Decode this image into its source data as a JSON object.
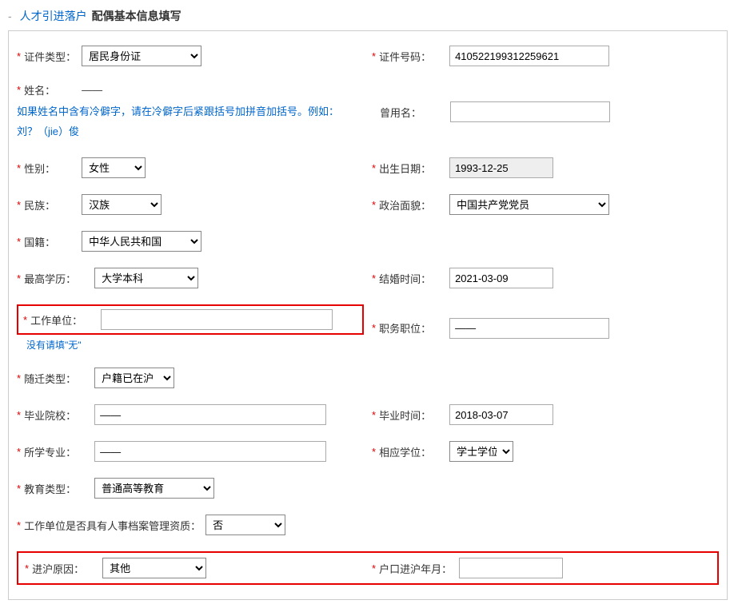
{
  "header": {
    "h1": "人才引进落户",
    "h2": "配偶基本信息填写"
  },
  "labels": {
    "idType": "证件类型：",
    "idNumber": "证件号码：",
    "name": "姓名：",
    "nameHint": "如果姓名中含有冷僻字，请在冷僻字后紧跟括号加拼音加括号。例如：刘？（jie）俊",
    "formerName": "曾用名：",
    "gender": "性别：",
    "birthDate": "出生日期：",
    "ethnicity": "民族：",
    "political": "政治面貌：",
    "nationality": "国籍：",
    "education": "最高学历：",
    "marryTime": "结婚时间：",
    "workUnit": "工作单位：",
    "workUnitHint": "没有请填\"无\"",
    "position": "职务职位：",
    "migrateType": "随迁类型：",
    "gradSchool": "毕业院校：",
    "gradTime": "毕业时间：",
    "major": "所学专业：",
    "degree": "相应学位：",
    "eduType": "教育类型：",
    "archiveQual": "工作单位是否具有人事档案管理资质：",
    "enterReason": "进沪原因：",
    "enterDate": "户口进沪年月："
  },
  "values": {
    "idType": "居民身份证",
    "idNumber": "410522199312259621",
    "name": "——",
    "formerName": "",
    "gender": "女性",
    "birthDate": "1993-12-25",
    "ethnicity": "汉族",
    "political": "中国共产党党员",
    "nationality": "中华人民共和国",
    "education": "大学本科",
    "marryTime": "2021-03-09",
    "workUnit": "",
    "position": "——",
    "migrateType": "户籍已在沪",
    "gradSchool": "——",
    "gradTime": "2018-03-07",
    "major": "——",
    "degree": "学士学位",
    "eduType": "普通高等教育",
    "archiveQual": "否",
    "enterReason": "其他",
    "enterDate": ""
  }
}
